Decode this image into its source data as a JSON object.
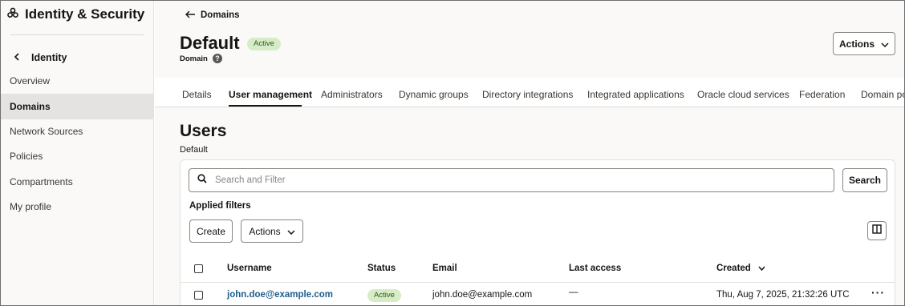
{
  "sidebar": {
    "title": "Identity & Security",
    "back_label": "Identity",
    "items": [
      {
        "label": "Overview"
      },
      {
        "label": "Domains",
        "active": true
      },
      {
        "label": "Network Sources"
      },
      {
        "label": "Policies"
      },
      {
        "label": "Compartments"
      },
      {
        "label": "My profile"
      }
    ]
  },
  "breadcrumb": {
    "label": "Domains"
  },
  "page": {
    "title": "Default",
    "status": "Active",
    "subtitle": "Domain",
    "actions_label": "Actions"
  },
  "tabs": [
    {
      "label": "Details"
    },
    {
      "label": "User management",
      "active": true
    },
    {
      "label": "Administrators"
    },
    {
      "label": "Dynamic groups"
    },
    {
      "label": "Directory integrations"
    },
    {
      "label": "Integrated applications"
    },
    {
      "label": "Oracle cloud services"
    },
    {
      "label": "Federation"
    },
    {
      "label": "Domain po"
    }
  ],
  "users": {
    "title": "Users",
    "subtitle": "Default",
    "search_placeholder": "Search and Filter",
    "search_button": "Search",
    "applied_filters": "Applied filters",
    "create_label": "Create",
    "actions_label": "Actions",
    "columns": {
      "username": "Username",
      "status": "Status",
      "email": "Email",
      "last_access": "Last access",
      "created": "Created"
    },
    "rows": [
      {
        "username": "john.doe@example.com",
        "status": "Active",
        "email": "john.doe@example.com",
        "last_access": "—",
        "created": "Thu, Aug 7, 2025, 21:32:26 UTC"
      }
    ]
  },
  "colors": {
    "accent_link": "#1f5e8a",
    "active_badge_bg": "#d6ecc7",
    "active_badge_text": "#2c5a18",
    "sidebar_bg": "#fbf9f8",
    "sidebar_active_bg": "#e5e3e1"
  }
}
